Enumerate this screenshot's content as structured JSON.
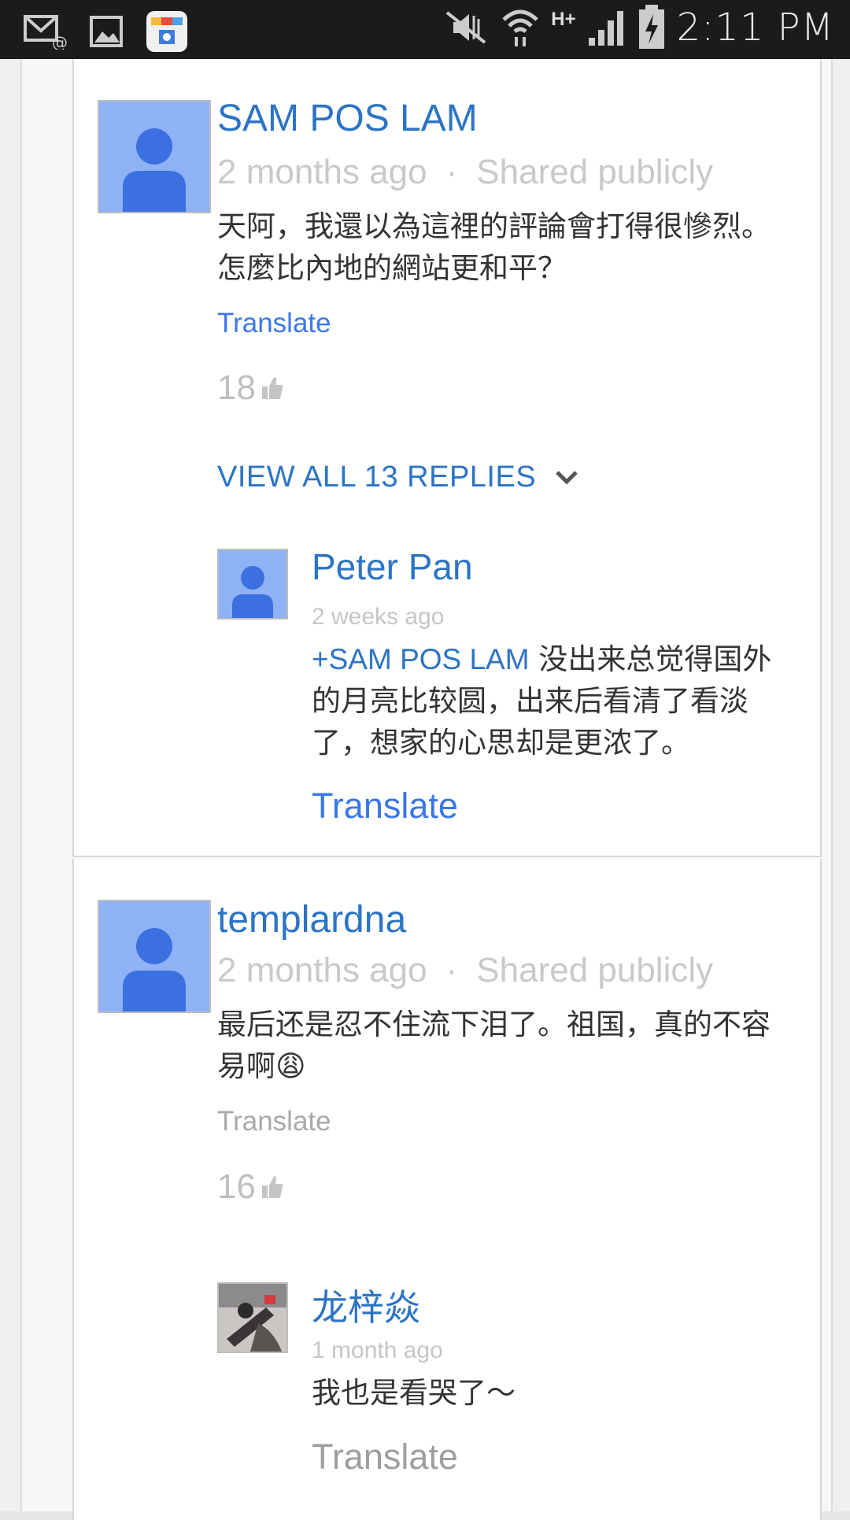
{
  "status_bar": {
    "time": "2:11 PM",
    "network": "H+",
    "icons": [
      "email-icon",
      "gallery-icon",
      "store-app-icon",
      "mute-icon",
      "wifi-icon",
      "signal-icon",
      "battery-charging-icon"
    ]
  },
  "comments": [
    {
      "author": "SAM POS LAM",
      "time": "2 months ago",
      "separator": "·",
      "visibility": "Shared publicly",
      "text": "天阿，我還以為這裡的評論會打得很慘烈。怎麼比內地的網站更和平？",
      "translate": "Translate",
      "likes": "18",
      "view_replies": "VIEW ALL 13 REPLIES",
      "reply": {
        "author": "Peter Pan",
        "time": "2 weeks ago",
        "mention": "+SAM POS LAM",
        "text": " 没出来总觉得国外的月亮比较圆，出来后看清了看淡了，想家的心思却是更浓了。",
        "translate": "Translate"
      }
    },
    {
      "author": "templardna",
      "time": "2 months ago",
      "separator": "·",
      "visibility": "Shared publicly",
      "text": "最后还是忍不住流下泪了。祖国，真的不容易啊😩",
      "translate": "Translate",
      "likes": "16",
      "reply": {
        "author": "龙梓焱",
        "time": "1 month ago",
        "text": "我也是看哭了～",
        "translate": "Translate"
      }
    }
  ],
  "colors": {
    "link_blue": "#2c74c4",
    "translate_blue": "#3b78e7",
    "meta_gray": "#c9c9c9",
    "avatar_blue": "#8fb2f6"
  }
}
